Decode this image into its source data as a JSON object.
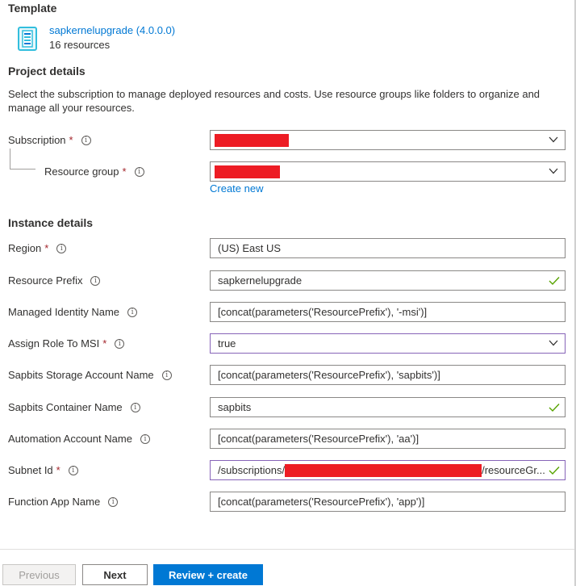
{
  "template": {
    "heading": "Template",
    "name": "sapkernelupgrade (4.0.0.0)",
    "resources": "16 resources"
  },
  "project": {
    "heading": "Project details",
    "description": "Select the subscription to manage deployed resources and costs. Use resource groups like folders to organize and manage all your resources.",
    "subscription_label": "Subscription",
    "resource_group_label": "Resource group",
    "create_new": "Create new"
  },
  "instance": {
    "heading": "Instance details",
    "region_label": "Region",
    "region_value": "(US) East US",
    "prefix_label": "Resource Prefix",
    "prefix_value": "sapkernelupgrade",
    "identity_label": "Managed Identity Name",
    "identity_value": "[concat(parameters('ResourcePrefix'), '-msi')]",
    "assign_label": "Assign Role To MSI",
    "assign_value": "true",
    "storage_label": "Sapbits Storage Account Name",
    "storage_value": "[concat(parameters('ResourcePrefix'), 'sapbits')]",
    "container_label": "Sapbits Container Name",
    "container_value": "sapbits",
    "automation_label": "Automation Account Name",
    "automation_value": "[concat(parameters('ResourcePrefix'), 'aa')]",
    "subnet_label": "Subnet Id",
    "subnet_prefix": "/subscriptions/",
    "subnet_suffix": "/resourceGr...",
    "function_label": "Function App Name",
    "function_value": "[concat(parameters('ResourcePrefix'), 'app')]"
  },
  "common": {
    "required_mark": "*",
    "info_glyph": "i"
  },
  "footer": {
    "previous": "Previous",
    "next": "Next",
    "review": "Review + create"
  },
  "colors": {
    "accent": "#0078d4",
    "required": "#a4262c",
    "valid_check": "#57a300",
    "redaction": "#ed1c24",
    "focus_border": "#8764b8"
  }
}
